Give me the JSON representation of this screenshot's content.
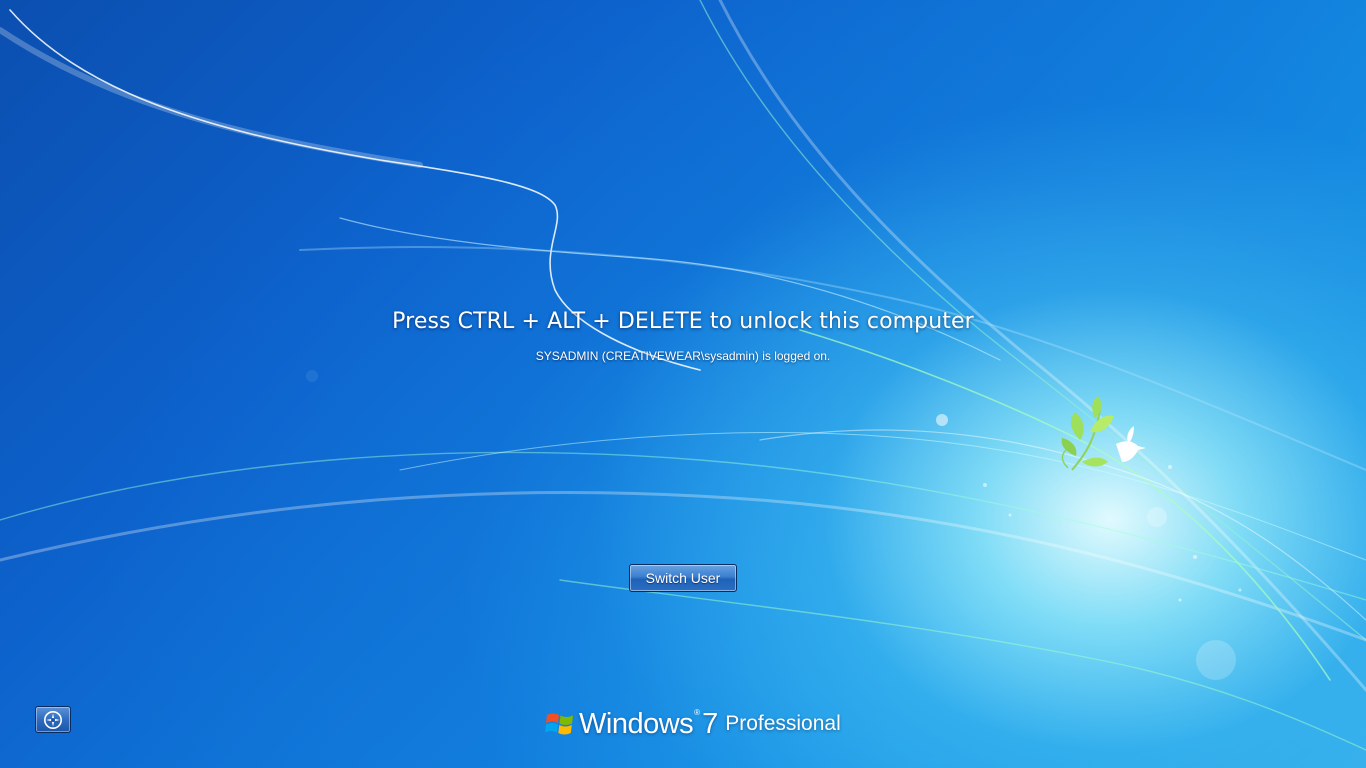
{
  "lock_screen": {
    "headline": "Press CTRL + ALT + DELETE to unlock this computer",
    "logged_on": "SYSADMIN (CREATIVEWEAR\\sysadmin) is logged on.",
    "switch_user_label": "Switch User"
  },
  "ease_of_access": {
    "icon": "ease-of-access-icon"
  },
  "branding": {
    "windows": "Windows",
    "trademark": "®",
    "version": "7",
    "edition": "Professional",
    "logo_icon": "windows-flag-icon"
  },
  "colors": {
    "background_dark": "#0b4fb0",
    "background_light": "#43c2ee",
    "button": "#2f6cc0",
    "text": "#ffffff"
  }
}
